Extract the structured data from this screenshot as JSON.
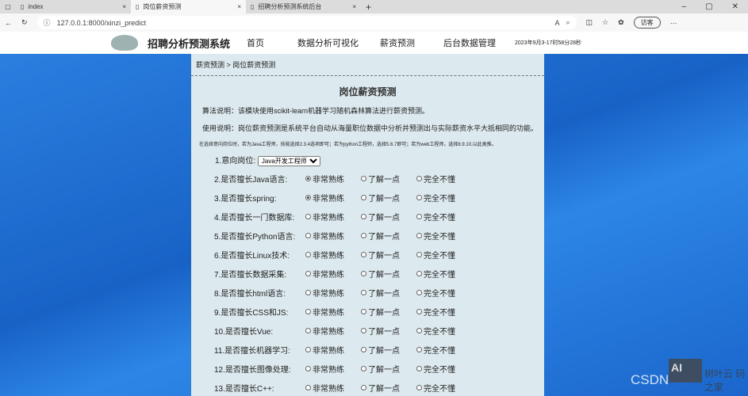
{
  "browser": {
    "tabs": [
      {
        "title": "index"
      },
      {
        "title": "岗位薪资预测"
      },
      {
        "title": "招聘分析预测系统后台"
      }
    ],
    "url": "127.0.0.1:8000/xinzi_predict",
    "visitor": "访客"
  },
  "site": {
    "brand": "招聘分析预测系统",
    "nav": [
      "首页",
      "数据分析可视化",
      "薪资预测",
      "后台数据管理"
    ],
    "time": "2023年9月3-17时58分28秒"
  },
  "main": {
    "breadcrumb": "薪资预测 > 岗位薪资预测",
    "title": "岗位薪资预测",
    "algo": "算法说明：该模块使用scikit-learn机器学习随机森林算法进行薪资预测。",
    "usage": "使用说明：岗位薪资预测是系统平台自动从海量职位数据中分析并预测出与实际薪资水平大抵相同的功能。",
    "hint": "在选择意向岗位时，若为Java工程师，技能选择2.3.4选项即可；若为python工程师，选择5.6.7即可；若为web工程师，选择8.9.10,以此类推。",
    "position_label": "1.意向岗位:",
    "position_value": "Java开发工程师",
    "options": [
      "非常熟练",
      "了解一点",
      "完全不懂"
    ],
    "questions": [
      {
        "label": "2.是否擅长Java语言:",
        "selected": 0
      },
      {
        "label": "3.是否擅长spring:",
        "selected": 0
      },
      {
        "label": "4.是否擅长一门数据库:",
        "selected": -1
      },
      {
        "label": "5.是否擅长Python语言:",
        "selected": -1
      },
      {
        "label": "6.是否擅长Linux技术:",
        "selected": -1
      },
      {
        "label": "7.是否擅长数据采集:",
        "selected": -1
      },
      {
        "label": "8.是否擅长html语言:",
        "selected": -1
      },
      {
        "label": "9.是否擅长CSS和JS:",
        "selected": -1
      },
      {
        "label": "10.是否擅长Vue:",
        "selected": -1
      },
      {
        "label": "11.是否擅长机器学习:",
        "selected": -1
      },
      {
        "label": "12.是否擅长图像处理:",
        "selected": -1
      },
      {
        "label": "13.是否擅长C++:",
        "selected": -1
      }
    ]
  },
  "watermark": {
    "csdn": "CSDN",
    "ai": "AI",
    "brand": "树叶云 码之家"
  }
}
